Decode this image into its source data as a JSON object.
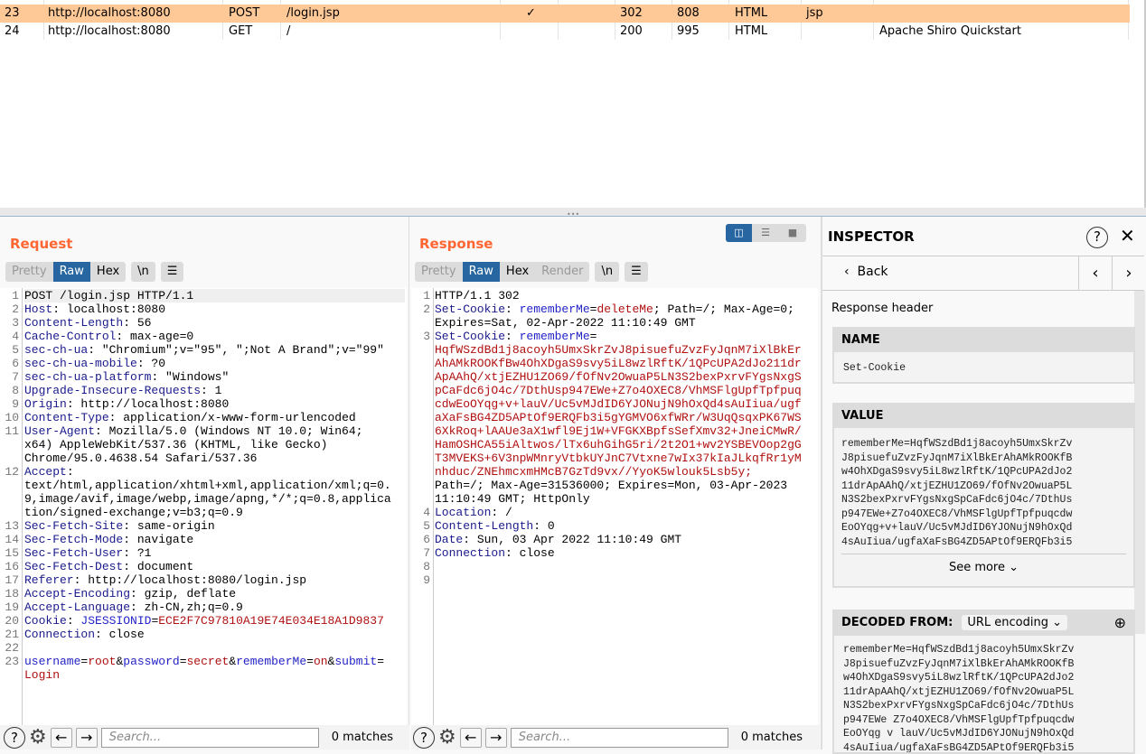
{
  "history": {
    "rows": [
      {
        "num": "23",
        "host": "http://localhost:8080",
        "method": "POST",
        "url": "/login.jsp",
        "edited": "✓",
        "status": "302",
        "length": "808",
        "mime": "HTML",
        "ext": "jsp",
        "title": "",
        "selected": true
      },
      {
        "num": "24",
        "host": "http://localhost:8080",
        "method": "GET",
        "url": "/",
        "edited": "",
        "status": "200",
        "length": "995",
        "mime": "HTML",
        "ext": "",
        "title": "Apache Shiro Quickstart",
        "selected": false
      }
    ]
  },
  "request": {
    "title": "Request",
    "tabs": [
      "Pretty",
      "Raw",
      "Hex"
    ],
    "active_tab": "Raw",
    "newline_label": "\\n",
    "lines": [
      [
        [
          [
            "POST /login.jsp HTTP/1.1",
            "v"
          ]
        ]
      ],
      [
        [
          [
            "Host",
            "k"
          ],
          [
            ": localhost:8080",
            "v"
          ]
        ]
      ],
      [
        [
          [
            "Content-Length",
            "k"
          ],
          [
            ": 56",
            "v"
          ]
        ]
      ],
      [
        [
          [
            "Cache-Control",
            "k"
          ],
          [
            ": max-age=0",
            "v"
          ]
        ]
      ],
      [
        [
          [
            "sec-ch-ua",
            "k"
          ],
          [
            ": \"Chromium\";v=\"95\", \";Not A Brand\";v=\"99\"",
            "v"
          ]
        ]
      ],
      [
        [
          [
            "sec-ch-ua-mobile",
            "k"
          ],
          [
            ": ?0",
            "v"
          ]
        ]
      ],
      [
        [
          [
            "sec-ch-ua-platform",
            "k"
          ],
          [
            ": \"Windows\"",
            "v"
          ]
        ]
      ],
      [
        [
          [
            "Upgrade-Insecure-Requests",
            "k"
          ],
          [
            ": 1",
            "v"
          ]
        ]
      ],
      [
        [
          [
            "Origin",
            "k"
          ],
          [
            ": http://localhost:8080",
            "v"
          ]
        ]
      ],
      [
        [
          [
            "Content-Type",
            "k"
          ],
          [
            ": application/x-www-form-urlencoded",
            "v"
          ]
        ]
      ],
      [
        [
          [
            "User-Agent",
            "k"
          ],
          [
            ": Mozilla/5.0 (Windows NT 10.0; Win64;",
            "v"
          ]
        ],
        [
          [
            "x64) AppleWebKit/537.36 (KHTML, like Gecko)",
            "v"
          ]
        ],
        [
          [
            "Chrome/95.0.4638.54 Safari/537.36",
            "v"
          ]
        ]
      ],
      [
        [
          [
            "Accept",
            "k"
          ],
          [
            ":",
            "v"
          ]
        ],
        [
          [
            "text/html,application/xhtml+xml,application/xml;q=0.",
            "v"
          ]
        ],
        [
          [
            "9,image/avif,image/webp,image/apng,*/*;q=0.8,applica",
            "v"
          ]
        ],
        [
          [
            "tion/signed-exchange;v=b3;q=0.9",
            "v"
          ]
        ]
      ],
      [
        [
          [
            "Sec-Fetch-Site",
            "k"
          ],
          [
            ": same-origin",
            "v"
          ]
        ]
      ],
      [
        [
          [
            "Sec-Fetch-Mode",
            "k"
          ],
          [
            ": navigate",
            "v"
          ]
        ]
      ],
      [
        [
          [
            "Sec-Fetch-User",
            "k"
          ],
          [
            ": ?1",
            "v"
          ]
        ]
      ],
      [
        [
          [
            "Sec-Fetch-Dest",
            "k"
          ],
          [
            ": document",
            "v"
          ]
        ]
      ],
      [
        [
          [
            "Referer",
            "k"
          ],
          [
            ": http://localhost:8080/login.jsp",
            "v"
          ]
        ]
      ],
      [
        [
          [
            "Accept-Encoding",
            "k"
          ],
          [
            ": gzip, deflate",
            "v"
          ]
        ]
      ],
      [
        [
          [
            "Accept-Language",
            "k"
          ],
          [
            ": zh-CN,zh;q=0.9",
            "v"
          ]
        ]
      ],
      [
        [
          [
            "Cookie",
            "k"
          ],
          [
            ": ",
            "v"
          ],
          [
            "JSESSIONID",
            "p"
          ],
          [
            "=",
            "v"
          ],
          [
            "ECE2F7C97810A19E74E034E18A1D9837",
            "r"
          ]
        ]
      ],
      [
        [
          [
            "Connection",
            "k"
          ],
          [
            ": close",
            "v"
          ]
        ]
      ],
      [
        [
          [
            "",
            "v"
          ]
        ]
      ],
      [
        [
          [
            "username",
            "p"
          ],
          [
            "=",
            "v"
          ],
          [
            "root",
            "r"
          ],
          [
            "&",
            "v"
          ],
          [
            "password",
            "p"
          ],
          [
            "=",
            "v"
          ],
          [
            "secret",
            "r"
          ],
          [
            "&",
            "v"
          ],
          [
            "rememberMe",
            "p"
          ],
          [
            "=",
            "v"
          ],
          [
            "on",
            "r"
          ],
          [
            "&",
            "v"
          ],
          [
            "submit",
            "p"
          ],
          [
            "=",
            "v"
          ]
        ],
        [
          [
            "Login",
            "r"
          ]
        ]
      ]
    ]
  },
  "response": {
    "title": "Response",
    "tabs": [
      "Pretty",
      "Raw",
      "Hex",
      "Render"
    ],
    "active_tab": "Raw",
    "newline_label": "\\n",
    "lines": [
      [
        [
          [
            "HTTP/1.1 302",
            "v"
          ]
        ]
      ],
      [
        [
          [
            "Set-Cookie",
            "k"
          ],
          [
            ": ",
            "v"
          ],
          [
            "rememberMe",
            "p"
          ],
          [
            "=",
            "v"
          ],
          [
            "deleteMe",
            "r"
          ],
          [
            "; Path=/; Max-Age=0;",
            "v"
          ]
        ],
        [
          [
            "Expires=Sat, 02-Apr-2022 11:10:49 GMT",
            "v"
          ]
        ]
      ],
      [
        [
          [
            "Set-Cookie",
            "k"
          ],
          [
            ": ",
            "v"
          ],
          [
            "rememberMe",
            "p"
          ],
          [
            "=",
            "v"
          ]
        ],
        [
          [
            "HqfWSzdBd1j8acoyh5UmxSkrZvJ8pisuefuZvzFyJqnM7iXlBkEr",
            "r"
          ]
        ],
        [
          [
            "AhAMkROOKfBw4OhXDgaS9svy5iL8wzlRftK/1QPcUPA2dJo211dr",
            "r"
          ]
        ],
        [
          [
            "ApAAhQ/xtjEZHU1ZO69/fOfNv2OwuaP5LN3S2bexPxrvFYgsNxgS",
            "r"
          ]
        ],
        [
          [
            "pCaFdc6jO4c/7DthUsp947EWe+Z7o4OXEC8/VhMSFlgUpfTpfpuq",
            "r"
          ]
        ],
        [
          [
            "cdwEoOYqg+v+lauV/Uc5vMJdID6YJONujN9hOxQd4sAuIiua/ugf",
            "r"
          ]
        ],
        [
          [
            "aXaFsBG4ZD5APtOf9ERQFb3i5gYGMVO6xfWRr/W3UqQsqxPK67WS",
            "r"
          ]
        ],
        [
          [
            "6XkRoq+lAAUe3aX1wfl9Ej1W+VFGKXBpfsSefXmv32+JneiCMwR/",
            "r"
          ]
        ],
        [
          [
            "HamOSHCA55iAltwos/lTx6uhGihG5ri/2t2O1+wv2YSBEVOop2gG",
            "r"
          ]
        ],
        [
          [
            "T3MVEKS+6V3npWMnryVtbkUYJnC7Vtxne7wIx37kIaJLkqfRr1yM",
            "r"
          ]
        ],
        [
          [
            "nhduc/ZNEhmcxmHMcB7GzTd9vx//YyoK5wlouk5Lsb5y;",
            "r"
          ]
        ],
        [
          [
            "Path=/; Max-Age=31536000; Expires=Mon, 03-Apr-2023",
            "v"
          ]
        ],
        [
          [
            "11:10:49 GMT; HttpOnly",
            "v"
          ]
        ]
      ],
      [
        [
          [
            "Location",
            "k"
          ],
          [
            ": /",
            "v"
          ]
        ]
      ],
      [
        [
          [
            "Content-Length",
            "k"
          ],
          [
            ": 0",
            "v"
          ]
        ]
      ],
      [
        [
          [
            "Date",
            "k"
          ],
          [
            ": Sun, 03 Apr 2022 11:10:49 GMT",
            "v"
          ]
        ]
      ],
      [
        [
          [
            "Connection",
            "k"
          ],
          [
            ": close",
            "v"
          ]
        ]
      ],
      [
        [
          [
            "",
            "v"
          ]
        ]
      ],
      [
        [
          [
            "",
            "v"
          ]
        ]
      ]
    ]
  },
  "search": {
    "placeholder": "Search...",
    "matches": "0 matches"
  },
  "inspector": {
    "title": "INSPECTOR",
    "back_label": "Back",
    "section": "Response header",
    "name_label": "NAME",
    "name_value": "Set-Cookie",
    "value_label": "VALUE",
    "value_text": "rememberMe=HqfWSzdBd1j8acoyh5UmxSkrZv\nJ8pisuefuZvzFyJqnM7iXlBkErAhAMkROOKfB\nw4OhXDgaS9svy5iL8wzlRftK/1QPcUPA2dJo2\n11drApAAhQ/xtjEZHU1ZO69/fOfNv2OwuaP5L\nN3S2bexPxrvFYgsNxgSpCaFdc6jO4c/7DthUs\np947EWe+Z7o4OXEC8/VhMSFlgUpfTpfpuqcdw\nEoOYqg+v+lauV/Uc5vMJdID6YJONujN9hOxQd\n4sAuIiua/ugfaXaFsBG4ZD5APtOf9ERQFb3i5",
    "see_more": "See more",
    "decoded_label": "DECODED FROM:",
    "decoded_from": "URL encoding",
    "decoded_text": "rememberMe=HqfWSzdBd1j8acoyh5UmxSkrZv\nJ8pisuefuZvzFyJqnM7iXlBkErAhAMkROOKfB\nw4OhXDgaS9svy5iL8wzlRftK/1QPcUPA2dJo2\n11drApAAhQ/xtjEZHU1ZO69/fOfNv2OwuaP5L\nN3S2bexPxrvFYgsNxgSpCaFdc6jO4c/7DthUs\np947EWe Z7o4OXEC8/VhMSFlgUpfTpfpuqcdw\nEoOYqg v lauV/Uc5vMJdID6YJONujN9hOxQd\n4sAuIiua/ugfaXaFsBG4ZD5APtOf9ERQFb3i5"
  },
  "colors": {
    "accent": "#ff6633",
    "selected_row": "#ffc897",
    "active_tab": "#2766a0"
  }
}
